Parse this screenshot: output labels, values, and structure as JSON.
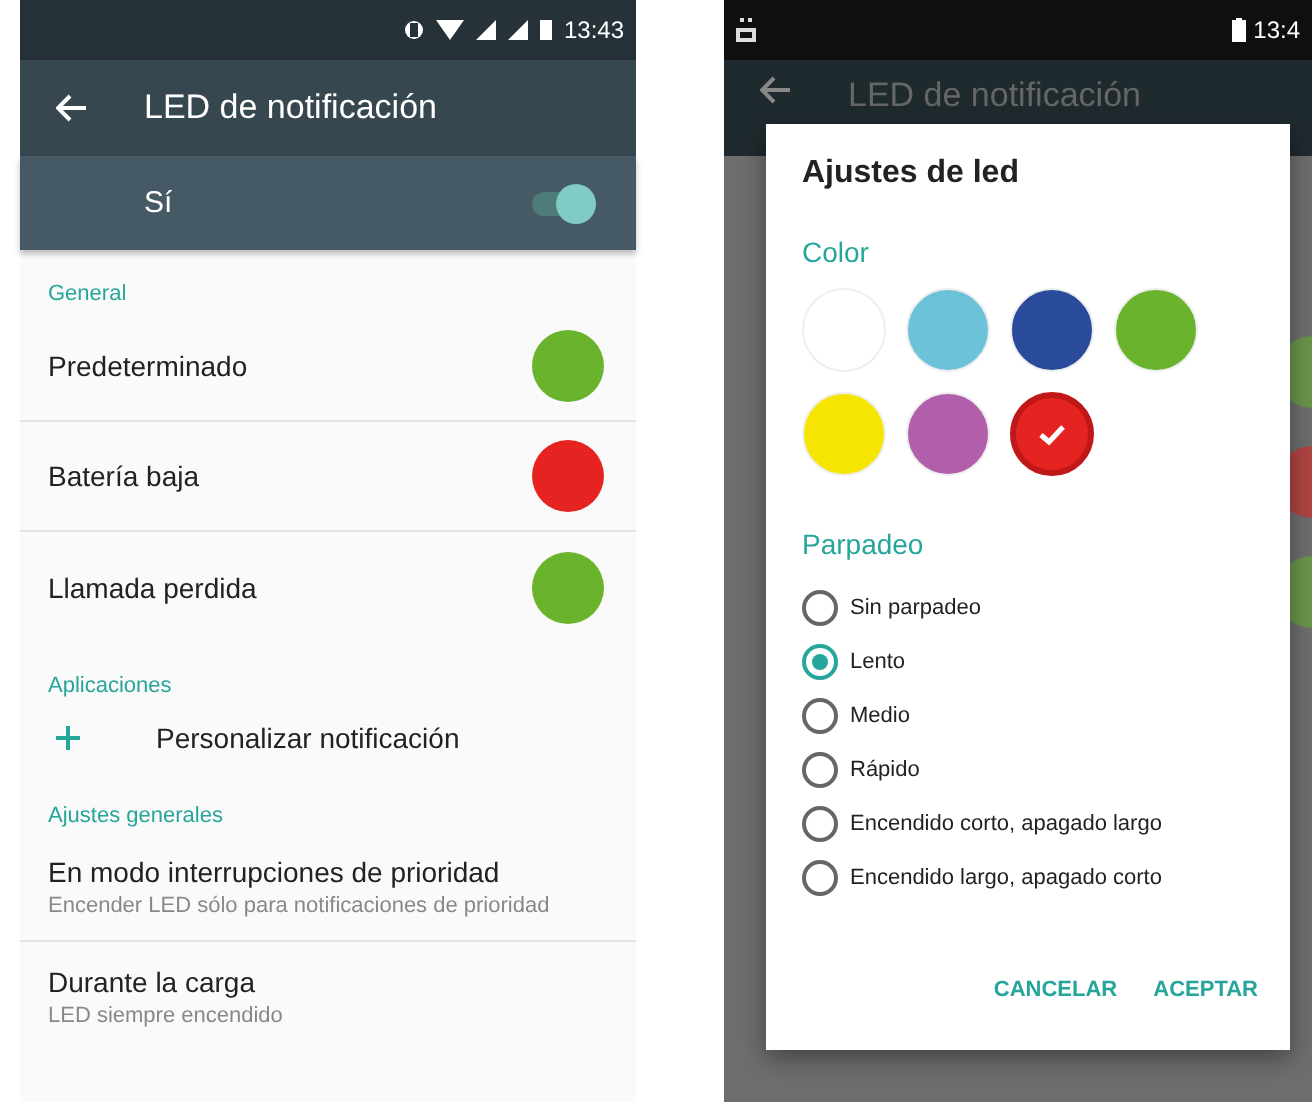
{
  "left_screen": {
    "status_bar": {
      "time": "13:43"
    },
    "toolbar": {
      "title": "LED de notificación"
    },
    "master_switch": {
      "label": "Sí",
      "on": true
    },
    "sections": [
      {
        "header": "General",
        "items": [
          {
            "kind": "color",
            "label": "Predeterminado",
            "color": "#6ab42d"
          },
          {
            "kind": "color",
            "label": "Batería baja",
            "color": "#e52421"
          },
          {
            "kind": "color",
            "label": "Llamada perdida",
            "color": "#6ab42d"
          }
        ]
      },
      {
        "header": "Aplicaciones",
        "items": [
          {
            "kind": "action",
            "label": "Personalizar notificación"
          }
        ]
      },
      {
        "header": "Ajustes generales",
        "items": [
          {
            "kind": "two_line",
            "label": "En modo interrupciones de prioridad",
            "summary": "Encender LED sólo para notificaciones de prioridad"
          },
          {
            "kind": "two_line",
            "label": "Durante la carga",
            "summary": "LED siempre encendido"
          }
        ]
      }
    ]
  },
  "right_screen": {
    "status_bar": {
      "time": "13:4"
    },
    "background_title": "LED de notificación",
    "dialog": {
      "title": "Ajustes de led",
      "color_header": "Color",
      "colors": [
        {
          "color": "#ffffff",
          "selected": false
        },
        {
          "color": "#6cc3d9",
          "selected": false
        },
        {
          "color": "#2a4a9b",
          "selected": false
        },
        {
          "color": "#6ab42d",
          "selected": false
        },
        {
          "color": "#f5e500",
          "selected": false
        },
        {
          "color": "#b15eab",
          "selected": false
        },
        {
          "color": "#e52421",
          "selected": true
        }
      ],
      "blink_header": "Parpadeo",
      "blink_options": [
        {
          "label": "Sin parpadeo",
          "selected": false
        },
        {
          "label": "Lento",
          "selected": true
        },
        {
          "label": "Medio",
          "selected": false
        },
        {
          "label": "Rápido",
          "selected": false
        },
        {
          "label": "Encendido corto, apagado largo",
          "selected": false
        },
        {
          "label": "Encendido largo, apagado corto",
          "selected": false
        }
      ],
      "buttons": [
        "CANCELAR",
        "ACEPTAR"
      ]
    }
  }
}
